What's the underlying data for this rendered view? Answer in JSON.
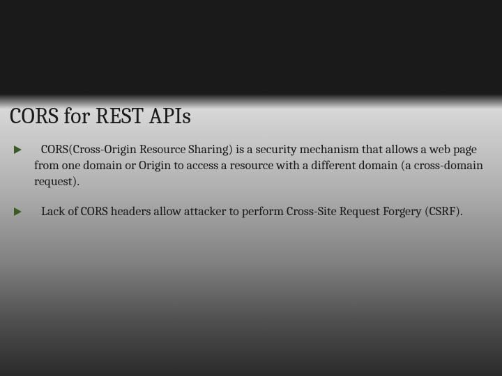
{
  "slide": {
    "title": "CORS  for REST APIs",
    "bullets": [
      {
        "text": "CORS(Cross-Origin Resource Sharing) is a security mechanism that allows a web page from one domain or Origin to access a resource with a different domain (a cross-domain request)."
      },
      {
        "text": "Lack of CORS headers allow attacker to perform Cross-Site Request Forgery (CSRF)."
      }
    ]
  },
  "colors": {
    "bullet_fill": "#3a5a2a"
  }
}
